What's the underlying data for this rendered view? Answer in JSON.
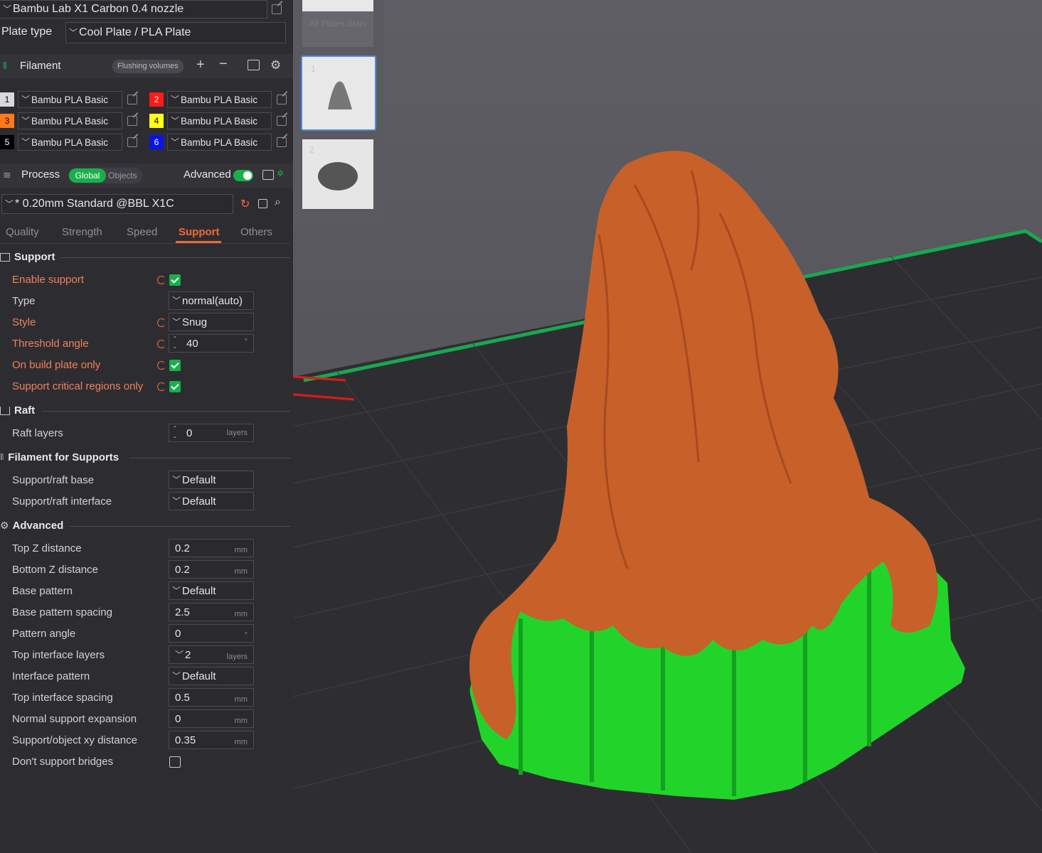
{
  "printer": {
    "name": "Bambu Lab X1 Carbon 0.4 nozzle"
  },
  "plate": {
    "label": "Plate type",
    "value": "Cool Plate / PLA Plate"
  },
  "filament": {
    "title": "Filament",
    "flushing_label": "Flushing volumes",
    "slots": [
      {
        "num": "1",
        "color": "#d9d9d9",
        "text_color": "#000000",
        "name": "Bambu PLA Basic"
      },
      {
        "num": "2",
        "color": "#ff1a1a",
        "text_color": "#ffffff",
        "name": "Bambu PLA Basic"
      },
      {
        "num": "3",
        "color": "#ff7a1a",
        "text_color": "#000000",
        "name": "Bambu PLA Basic"
      },
      {
        "num": "4",
        "color": "#ffff1a",
        "text_color": "#000000",
        "name": "Bambu PLA Basic"
      },
      {
        "num": "5",
        "color": "#000000",
        "text_color": "#ffffff",
        "name": "Bambu PLA Basic"
      },
      {
        "num": "6",
        "color": "#0a14e6",
        "text_color": "#ffffff",
        "name": "Bambu PLA Basic"
      }
    ]
  },
  "process": {
    "title": "Process",
    "global_label": "Global",
    "objects_label": "Objects",
    "advanced_label": "Advanced",
    "preset": "* 0.20mm Standard @BBL X1C"
  },
  "tabs": [
    {
      "label": "Quality"
    },
    {
      "label": "Strength"
    },
    {
      "label": "Speed"
    },
    {
      "label": "Support"
    },
    {
      "label": "Others"
    }
  ],
  "support": {
    "title": "Support",
    "enable_label": "Enable support",
    "type_label": "Type",
    "type_value": "normal(auto)",
    "style_label": "Style",
    "style_value": "Snug",
    "threshold_label": "Threshold angle",
    "threshold_value": "40",
    "threshold_unit": "°",
    "build_plate_label": "On build plate only",
    "critical_label": "Support critical regions only"
  },
  "raft": {
    "title": "Raft",
    "layers_label": "Raft layers",
    "layers_value": "0",
    "layers_unit": "layers"
  },
  "filament_supports": {
    "title": "Filament for Supports",
    "base_label": "Support/raft base",
    "base_value": "Default",
    "interface_label": "Support/raft interface",
    "interface_value": "Default"
  },
  "advanced": {
    "title": "Advanced",
    "rows": [
      {
        "label": "Top Z distance",
        "value": "0.2",
        "unit": "mm"
      },
      {
        "label": "Bottom Z distance",
        "value": "0.2",
        "unit": "mm"
      },
      {
        "label": "Base pattern",
        "value": "Default",
        "unit": ""
      },
      {
        "label": "Base pattern spacing",
        "value": "2.5",
        "unit": "mm"
      },
      {
        "label": "Pattern angle",
        "value": "0",
        "unit": "°"
      },
      {
        "label": "Top interface layers",
        "value": "2",
        "unit": "layers"
      },
      {
        "label": "Interface pattern",
        "value": "Default",
        "unit": ""
      },
      {
        "label": "Top interface spacing",
        "value": "0.5",
        "unit": "mm"
      },
      {
        "label": "Normal support expansion",
        "value": "0",
        "unit": "mm"
      },
      {
        "label": "Support/object xy distance",
        "value": "0.35",
        "unit": "mm"
      }
    ],
    "bridges_label": "Don't support bridges"
  },
  "plates": {
    "stats_label": "All Plates Stats",
    "plate1": "1",
    "plate2": "2"
  },
  "colors": {
    "accent": "#ef6b35",
    "green": "#19b04c",
    "model_orange": "#c8602a",
    "support_green": "#22d42a"
  }
}
